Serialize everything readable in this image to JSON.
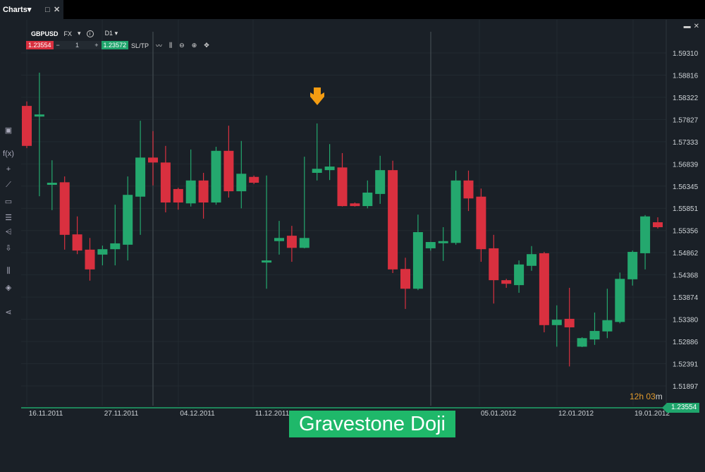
{
  "tab": {
    "label": "Charts",
    "caret": "▾"
  },
  "symbol": {
    "name": "GBPUSD",
    "type": "FX",
    "timeframe": "D1"
  },
  "trade": {
    "sell_price": "1.23554",
    "buy_price": "1.23572",
    "quantity": "1",
    "minus": "−",
    "plus": "+",
    "sltp": "SL/TP"
  },
  "timer": {
    "hours": "12h 03",
    "unit": "m"
  },
  "current_price": "1.23554",
  "pattern_label": "Gravestone Doji",
  "colors": {
    "bull": "#24a86e",
    "bear": "#d9303f",
    "background": "#1a2027",
    "marker": "#f39c12"
  },
  "left_toolbar": [
    "screen-icon",
    "function-icon",
    "crosshair-icon",
    "line-draw-icon",
    "rectangle-icon",
    "fibonacci-icon",
    "fan-icon",
    "arrow-down-icon",
    "indicators-icon",
    "layers-icon",
    "share-icon"
  ],
  "chart_data": {
    "type": "candlestick",
    "symbol": "GBPUSD",
    "timeframe": "D1",
    "ylim": [
      1.5165,
      1.5955
    ],
    "y_ticks": [
      "1.59310",
      "1.58816",
      "1.58322",
      "1.57827",
      "1.57333",
      "1.56839",
      "1.56345",
      "1.55851",
      "1.55356",
      "1.54862",
      "1.54368",
      "1.53874",
      "1.53380",
      "1.52886",
      "1.52391",
      "1.51897"
    ],
    "x_tick_labels": [
      "16.11.2011",
      "27.11.2011",
      "04.12.2011",
      "11.12.2011",
      "05.01.2012",
      "12.01.2012",
      "19.01.2012"
    ],
    "annotation": {
      "text": "Gravestone Doji",
      "candle_index": 23,
      "marker": "down-arrow"
    },
    "candles": [
      [
        1.5813,
        1.5823,
        1.5719,
        1.5724
      ],
      [
        1.5792,
        1.5887,
        1.5612,
        1.5794
      ],
      [
        1.5639,
        1.5692,
        1.5581,
        1.5642
      ],
      [
        1.5643,
        1.5656,
        1.5493,
        1.5526
      ],
      [
        1.5527,
        1.5567,
        1.5483,
        1.5491
      ],
      [
        1.5493,
        1.5519,
        1.5424,
        1.5449
      ],
      [
        1.5482,
        1.5502,
        1.5458,
        1.5494
      ],
      [
        1.5494,
        1.5593,
        1.5458,
        1.5507
      ],
      [
        1.5504,
        1.5656,
        1.5469,
        1.5615
      ],
      [
        1.5611,
        1.578,
        1.5526,
        1.5698
      ],
      [
        1.5698,
        1.5757,
        1.5636,
        1.5687
      ],
      [
        1.5687,
        1.5724,
        1.5576,
        1.5598
      ],
      [
        1.5628,
        1.5631,
        1.5582,
        1.5598
      ],
      [
        1.5596,
        1.5716,
        1.5589,
        1.5647
      ],
      [
        1.5647,
        1.5664,
        1.5562,
        1.5598
      ],
      [
        1.5598,
        1.5722,
        1.5593,
        1.5713
      ],
      [
        1.5713,
        1.5769,
        1.5609,
        1.5623
      ],
      [
        1.5623,
        1.5735,
        1.5585,
        1.5662
      ],
      [
        1.5655,
        1.5658,
        1.5639,
        1.5642
      ],
      [
        1.5466,
        1.5658,
        1.5406,
        1.5469
      ],
      [
        1.5512,
        1.5557,
        1.5482,
        1.5519
      ],
      [
        1.5524,
        1.5546,
        1.5466,
        1.5497
      ],
      [
        1.5497,
        1.57,
        1.5496,
        1.5519
      ],
      [
        1.5664,
        1.5774,
        1.5647,
        1.5673
      ],
      [
        1.567,
        1.5728,
        1.5648,
        1.5678
      ],
      [
        1.5676,
        1.5708,
        1.5589,
        1.559
      ],
      [
        1.5596,
        1.5598,
        1.5589,
        1.559
      ],
      [
        1.559,
        1.5647,
        1.5585,
        1.562
      ],
      [
        1.5617,
        1.5702,
        1.5595,
        1.567
      ],
      [
        1.567,
        1.5691,
        1.5441,
        1.5449
      ],
      [
        1.545,
        1.5475,
        1.5361,
        1.5406
      ],
      [
        1.5406,
        1.5571,
        1.5403,
        1.5532
      ],
      [
        1.5496,
        1.551,
        1.5491,
        1.551
      ],
      [
        1.5508,
        1.5543,
        1.5468,
        1.5512
      ],
      [
        1.5508,
        1.5669,
        1.5504,
        1.5647
      ],
      [
        1.5647,
        1.5669,
        1.5579,
        1.5607
      ],
      [
        1.5611,
        1.5629,
        1.5466,
        1.5494
      ],
      [
        1.5496,
        1.5526,
        1.5373,
        1.5425
      ],
      [
        1.5425,
        1.5428,
        1.5408,
        1.5417
      ],
      [
        1.5414,
        1.5469,
        1.5397,
        1.546
      ],
      [
        1.5457,
        1.5501,
        1.5446,
        1.5483
      ],
      [
        1.5485,
        1.5488,
        1.5309,
        1.5325
      ],
      [
        1.5325,
        1.5369,
        1.5277,
        1.5337
      ],
      [
        1.5339,
        1.5408,
        1.5233,
        1.532
      ],
      [
        1.5277,
        1.5298,
        1.5276,
        1.5296
      ],
      [
        1.5293,
        1.5353,
        1.5281,
        1.5312
      ],
      [
        1.5311,
        1.5406,
        1.5296,
        1.5336
      ],
      [
        1.5332,
        1.5442,
        1.5329,
        1.5428
      ],
      [
        1.5427,
        1.5491,
        1.5413,
        1.5488
      ],
      [
        1.5485,
        1.557,
        1.5449,
        1.5567
      ],
      [
        1.5554,
        1.5565,
        1.554,
        1.5543
      ]
    ]
  }
}
